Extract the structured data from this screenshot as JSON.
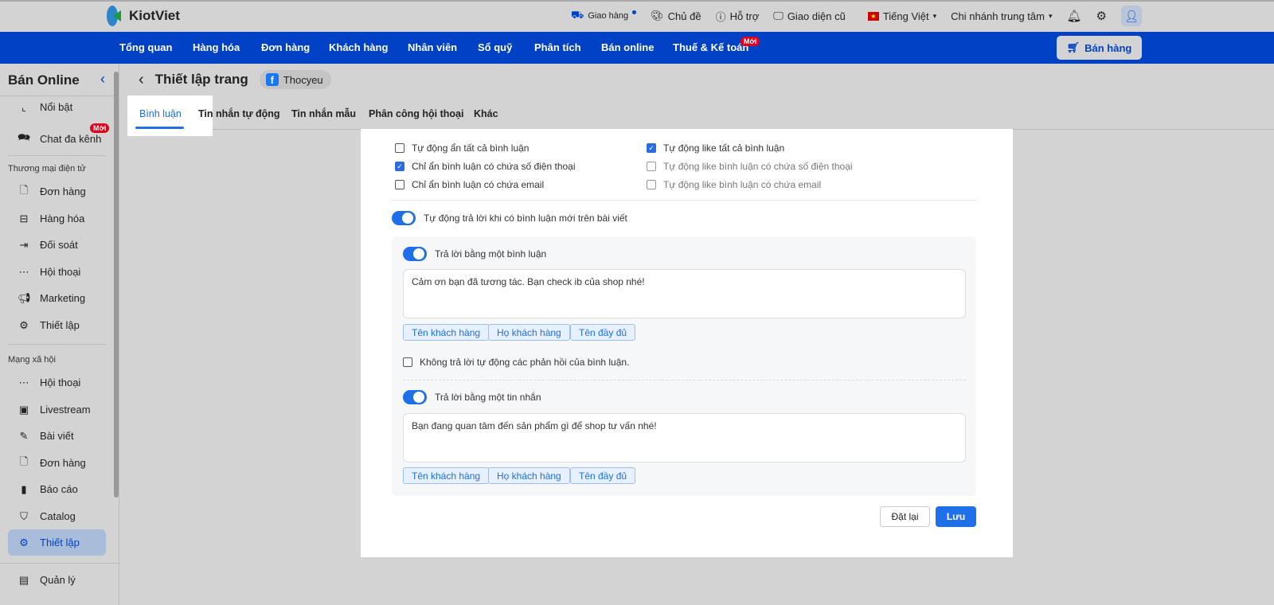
{
  "app": {
    "name": "KiotViet"
  },
  "top": {
    "delivery": "Giao hàng",
    "theme": "Chủ đề",
    "support": "Hỗ trợ",
    "old_ui": "Giao diện cũ",
    "language": "Tiếng Việt",
    "branch": "Chi nhánh trung tâm"
  },
  "nav": {
    "items": [
      "Tổng quan",
      "Hàng hóa",
      "Đơn hàng",
      "Khách hàng",
      "Nhân viên",
      "Sổ quỹ",
      "Phân tích",
      "Bán online",
      "Thuế & Kế toán"
    ],
    "new_badge": "Mới",
    "sell_button": "Bán hàng"
  },
  "sidebar": {
    "title": "Bán Online",
    "items_top": [
      "Nổi bật",
      "Chat đa kênh"
    ],
    "new_badge": "Mới",
    "section1": "Thương mại điện tử",
    "items1": [
      "Đơn hàng",
      "Hàng hóa",
      "Đối soát",
      "Hội thoại",
      "Marketing",
      "Thiết lập"
    ],
    "section2": "Mạng xã hội",
    "items2": [
      "Hội thoại",
      "Livestream",
      "Bài viết",
      "Đơn hàng",
      "Báo cáo",
      "Catalog",
      "Thiết lập"
    ],
    "bottom": "Quản lý"
  },
  "page": {
    "title": "Thiết lập trang",
    "page_name": "Thocyeu"
  },
  "tabs": [
    "Bình luận",
    "Tin nhắn tự động",
    "Tin nhắn mẫu",
    "Phân công hội thoại",
    "Khác"
  ],
  "settings": {
    "hide": [
      {
        "label": "Tự động ẩn tất cả bình luận",
        "checked": false
      },
      {
        "label": "Chỉ ẩn bình luận có chứa số điện thoại",
        "checked": true
      },
      {
        "label": "Chỉ ẩn bình luận có chứa email",
        "checked": false
      }
    ],
    "like": [
      {
        "label": "Tự động like tất cả bình luận",
        "checked": true
      },
      {
        "label": "Tự động like bình luận có chứa số điện thoại",
        "checked": false
      },
      {
        "label": "Tự động like bình luận có chứa email",
        "checked": false
      }
    ],
    "auto_reply": "Tự động trả lời khi có bình luận mới trên bài viết",
    "reply_comment": "Trả lời bằng một bình luận",
    "reply_comment_text": "Cảm ơn bạn đã tương tác. Bạn check ib của shop nhé!",
    "chips": [
      "Tên khách hàng",
      "Họ khách hàng",
      "Tên đầy đủ"
    ],
    "no_reply": "Không trả lời tự động các phản hồi của bình luận.",
    "reply_message": "Trả lời bằng một tin nhắn",
    "reply_message_text": "Bạn đang quan tâm đến sản phẩm gì để shop tư vấn nhé!",
    "reset": "Đặt lại",
    "save": "Lưu"
  }
}
